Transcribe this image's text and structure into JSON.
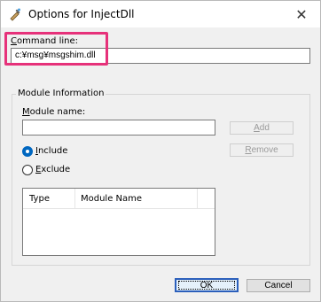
{
  "window": {
    "title": "Options for InjectDll",
    "close_glyph": "✕"
  },
  "command_line": {
    "label_prefix": "",
    "label_underlined": "C",
    "label_rest": "ommand line:",
    "value": "c:¥msg¥msgshim.dll"
  },
  "module_info": {
    "group_title": "Module Information",
    "name_label_underlined": "M",
    "name_label_rest": "odule name:",
    "name_value": "",
    "add_button": {
      "underlined": "A",
      "rest": "dd"
    },
    "remove_button": {
      "underlined": "R",
      "rest": "emove"
    },
    "include": {
      "underlined": "I",
      "rest": "nclude",
      "checked": true
    },
    "exclude": {
      "underlined": "E",
      "rest": "xclude",
      "checked": false
    },
    "list_columns": [
      "Type",
      "Module Name"
    ]
  },
  "buttons": {
    "ok": "OK",
    "cancel": "Cancel"
  },
  "colors": {
    "highlight": "#e6317a",
    "accent": "#0067c0"
  }
}
